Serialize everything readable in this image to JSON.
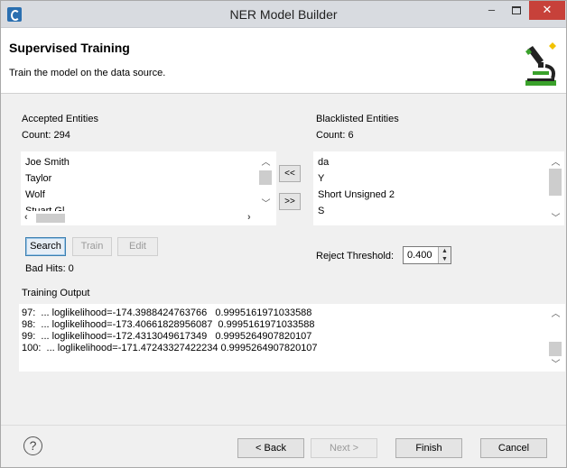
{
  "window": {
    "title": "NER Model Builder",
    "controls": {
      "minimize": "–",
      "close": "✕"
    }
  },
  "header": {
    "title": "Supervised Training",
    "description": "Train the model on the data source.",
    "icon": "microscope-icon"
  },
  "accepted": {
    "label": "Accepted Entities",
    "count_text": "Count: 294",
    "items": [
      "Joe Smith",
      "Taylor",
      "Wolf",
      "Stuart Gl..."
    ]
  },
  "blacklisted": {
    "label": "Blacklisted Entities",
    "count_text": "Count: 6",
    "items": [
      "da",
      "Y",
      "Short Unsigned 2",
      "S"
    ]
  },
  "transfer": {
    "move_left": "<<",
    "move_right": ">>"
  },
  "actions": {
    "search": "Search",
    "train": "Train",
    "edit": "Edit"
  },
  "bad_hits": "Bad Hits: 0",
  "reject_threshold": {
    "label": "Reject Threshold:",
    "value": "0.400"
  },
  "training_output": {
    "label": "Training Output",
    "lines": [
      "97:  ... loglikelihood=-174.3988424763766   0.9995161971033588",
      "98:  ... loglikelihood=-173.40661828956087  0.9995161971033588",
      "99:  ... loglikelihood=-172.4313049617349   0.9995264907820107",
      "100:  ... loglikelihood=-171.47243327422234 0.9995264907820107"
    ]
  },
  "footer": {
    "help": "?",
    "back": "< Back",
    "next": "Next >",
    "finish": "Finish",
    "cancel": "Cancel"
  },
  "colors": {
    "close_button": "#c7413a",
    "focus_border": "#3c7fb1",
    "window_bg": "#f0f0f0"
  }
}
